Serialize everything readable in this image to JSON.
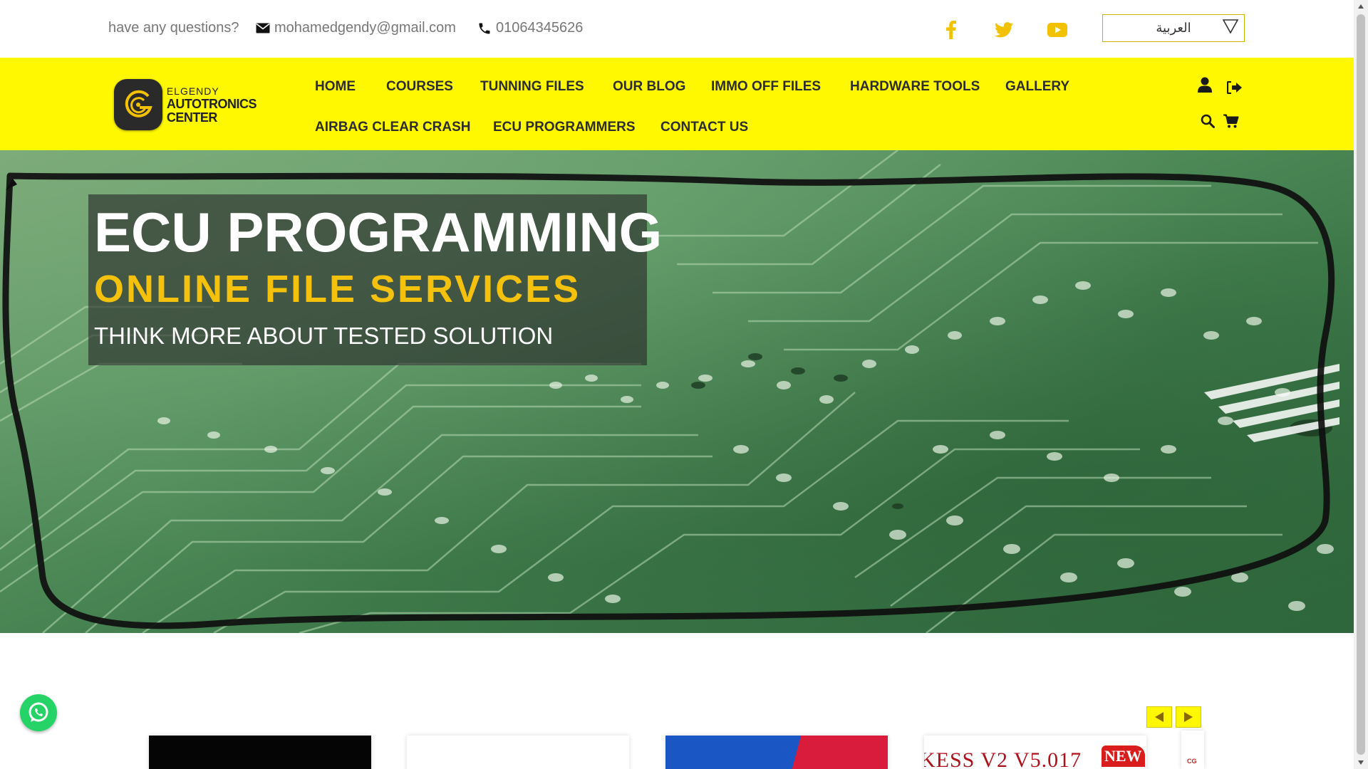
{
  "topbar": {
    "question": "have any questions?",
    "email": "mohamedgendy@gmail.com",
    "phone": "01064345626",
    "social": [
      {
        "icon": "facebook-icon"
      },
      {
        "icon": "twitter-icon"
      },
      {
        "icon": "youtube-icon"
      }
    ],
    "language": "العربية",
    "accent_color": "#f2c200"
  },
  "logo": {
    "line1": "ELGENDY",
    "line2": "AUTOTRONICS",
    "line3": "CENTER"
  },
  "nav": {
    "items": [
      "HOME",
      "COURSES",
      "TUNNING FILES",
      "OUR BLOG",
      "IMMO OFF FILES",
      "HARDWARE TOOLS",
      "GALLERY",
      "AIRBAG CLEAR CRASH",
      "ECU PROGRAMMERS",
      "CONTACT US"
    ],
    "icons": [
      "user-icon",
      "logout-icon",
      "search-icon",
      "cart-icon"
    ],
    "background": "#fff800"
  },
  "hero": {
    "title": "ECU PROGRAMMING",
    "subtitle": "ONLINE FILE SERVICES",
    "tagline": "THINK MORE ABOUT TESTED SOLUTION",
    "subtitle_color": "#f4c20d"
  },
  "products": {
    "cards": [
      {
        "name": "product-card-1"
      },
      {
        "name": "product-card-2"
      },
      {
        "name": "product-card-3"
      },
      {
        "name": "product-card-4",
        "title": "KESS V2 V5.017",
        "badge": "NEW"
      }
    ],
    "peek_text": "CG"
  },
  "whatsapp": {
    "icon": "whatsapp-icon",
    "color": "#25d366"
  }
}
